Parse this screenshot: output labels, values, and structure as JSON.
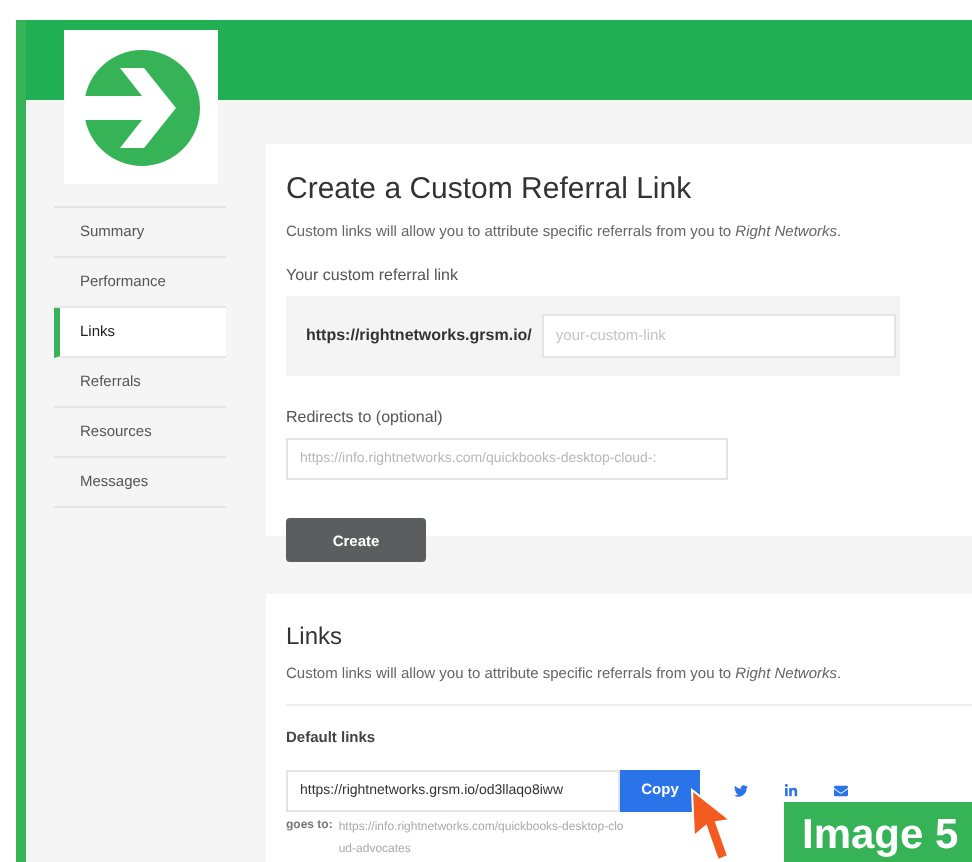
{
  "sidebar": {
    "items": [
      {
        "label": "Summary",
        "selected": false
      },
      {
        "label": "Performance",
        "selected": false
      },
      {
        "label": "Links",
        "selected": true
      },
      {
        "label": "Referrals",
        "selected": false
      },
      {
        "label": "Resources",
        "selected": false
      },
      {
        "label": "Messages",
        "selected": false
      }
    ]
  },
  "create_card": {
    "title": "Create a Custom Referral Link",
    "description": "Custom links will allow you to attribute specific referrals from you to *Right Networks*.",
    "link_label": "Your custom referral link",
    "prefix": "https://rightnetworks.grsm.io/",
    "link_placeholder": "your-custom-link",
    "redirect_label": "Redirects to (optional)",
    "redirect_placeholder": "https://info.rightnetworks.com/quickbooks-desktop-cloud-:",
    "button": "Create"
  },
  "links_card": {
    "title": "Links",
    "description": "Custom links will allow you to attribute specific referrals from you to *Right Networks*.",
    "section": "Default links",
    "link_value": "https://rightnetworks.grsm.io/od3llaqo8iww",
    "copy_button": "Copy",
    "goes_to_label": "goes to:",
    "goes_to_url": "https://info.rightnetworks.com/quickbooks-desktop-cloud-advocates"
  },
  "caption": "Image 5"
}
